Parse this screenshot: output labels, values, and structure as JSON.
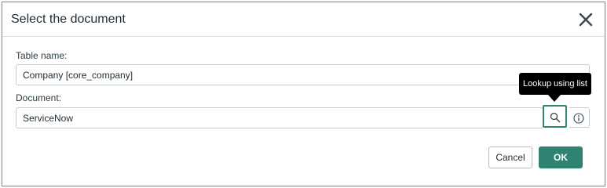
{
  "dialog": {
    "title": "Select the document",
    "close_icon": "close-icon"
  },
  "form": {
    "table_name_label": "Table name:",
    "table_name_value": "Company [core_company]",
    "document_label": "Document:",
    "document_value": "ServiceNow",
    "lookup_icon": "search-icon",
    "info_icon": "info-icon",
    "lookup_tooltip": "Lookup using list"
  },
  "buttons": {
    "cancel_label": "Cancel",
    "ok_label": "OK"
  },
  "colors": {
    "accent": "#2e8373",
    "tooltip_bg": "#000000"
  }
}
